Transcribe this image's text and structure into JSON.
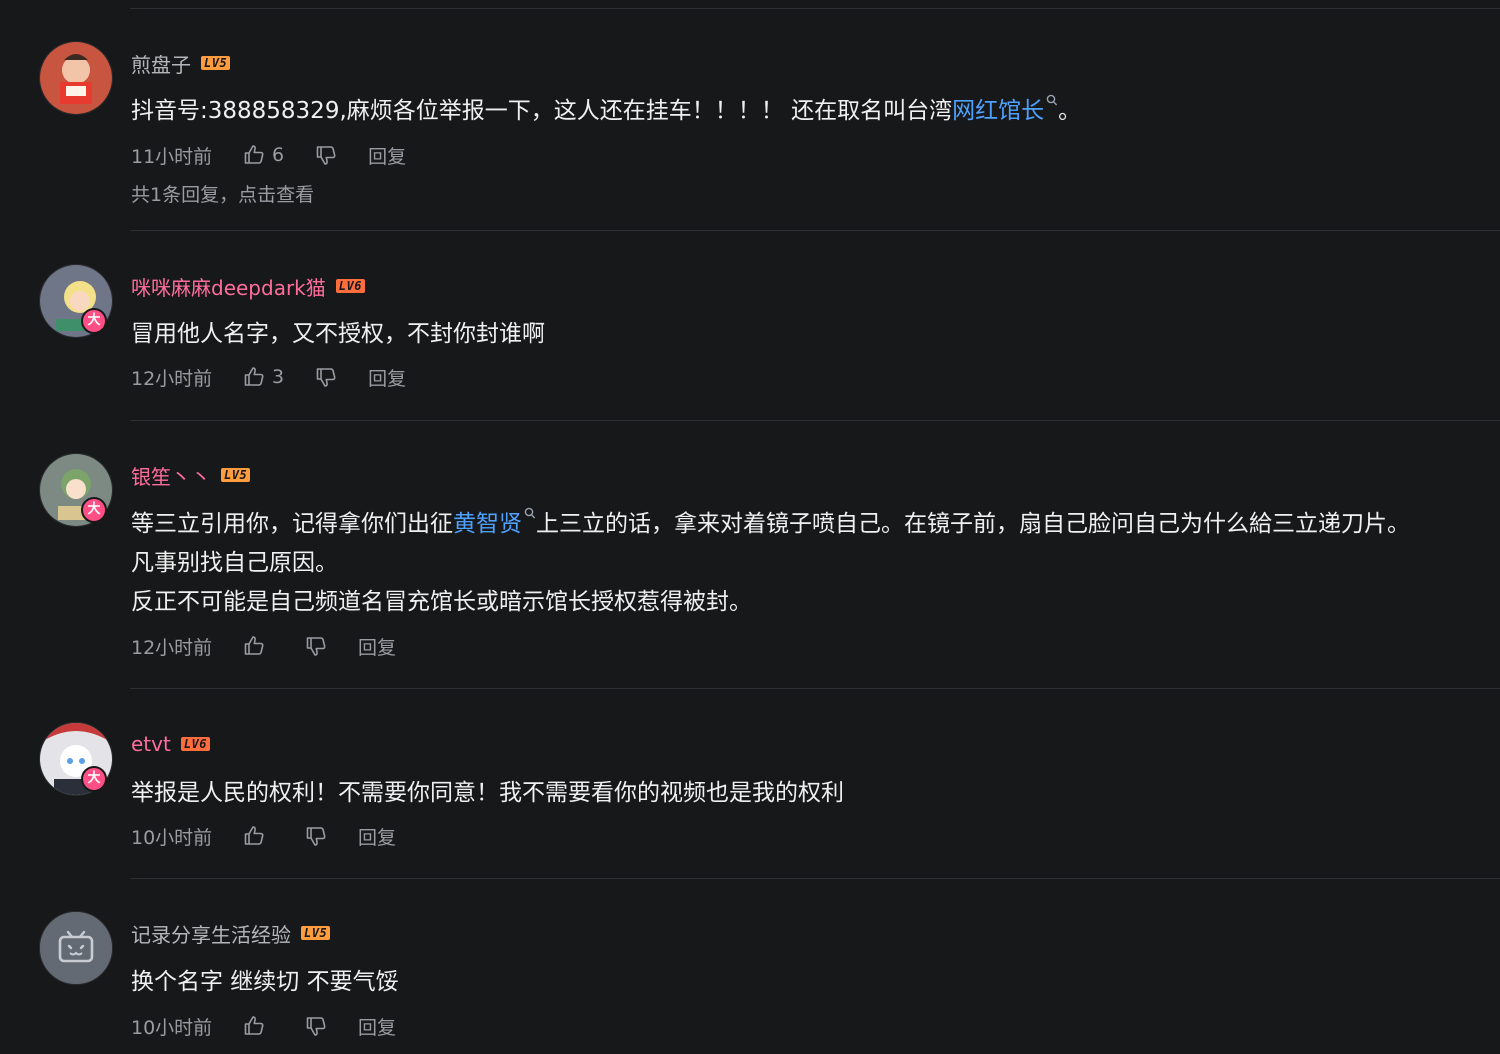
{
  "reply_label": "回复",
  "comments": [
    {
      "username": "煎盘子",
      "level": "LV5",
      "content_lines": [
        {
          "pre": "抖音号:388858329,麻烦各位举报一下，这人还在挂车！！！！ 还在取名叫台湾",
          "keyword": "网红馆长",
          "post": "。"
        }
      ],
      "time": "11小时前",
      "likes": "6",
      "more_replies": "共1条回复，点击查看"
    },
    {
      "username": "咪咪麻麻deepdark猫",
      "level": "LV6",
      "content_lines": [
        {
          "pre": "冒用他人名字，又不授权，不封你封谁啊",
          "keyword": "",
          "post": ""
        }
      ],
      "time": "12小时前",
      "likes": "3"
    },
    {
      "username": "银笙丶丶",
      "level": "LV5",
      "content_lines": [
        {
          "pre": "等三立引用你，记得拿你们出征",
          "keyword": "黄智贤",
          "post": "上三立的话，拿来对着镜子喷自己。在镜子前，扇自己脸问自己为什么給三立递刀片。"
        },
        {
          "pre": "凡事别找自己原因。",
          "keyword": "",
          "post": ""
        },
        {
          "pre": "反正不可能是自己频道名冒充馆长或暗示馆长授权惹得被封。",
          "keyword": "",
          "post": ""
        }
      ],
      "time": "12小时前",
      "likes": ""
    },
    {
      "username": "etvt",
      "level": "LV6",
      "content_lines": [
        {
          "pre": "举报是人民的权利！不需要你同意！我不需要看你的视频也是我的权利",
          "keyword": "",
          "post": ""
        }
      ],
      "time": "10小时前",
      "likes": ""
    },
    {
      "username": "记录分享生活经验",
      "level": "LV5",
      "content_lines": [
        {
          "pre": "换个名字 继续切 不要气馁",
          "keyword": "",
          "post": ""
        }
      ],
      "time": "10小时前",
      "likes": ""
    }
  ],
  "badges": {
    "vip_mark": "大"
  },
  "colors": {
    "background": "#17181a",
    "vip_name": "#ff6d9b",
    "keyword_link": "#4ea1ff",
    "level_badge": "#ff9c3d"
  }
}
